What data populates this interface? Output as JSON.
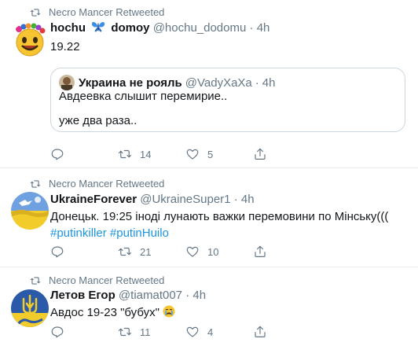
{
  "tweets": [
    {
      "retweeted_by": "Necro Mancer Retweeted",
      "name_part1": "hochu",
      "name_emoji": "butterfly-icon",
      "name_part2": "domoy",
      "handle": "@hochu_dodomu",
      "dot": "·",
      "time": "4h",
      "text": "19.22",
      "quote": {
        "name": "Украина не рояль",
        "handle": "@VadyXaXa",
        "dot": "·",
        "time": "4h",
        "line1": "Авдеевка слышит перемирие..",
        "line2": "уже два раза.."
      },
      "retweets": "14",
      "likes": "5"
    },
    {
      "retweeted_by": "Necro Mancer Retweeted",
      "name": "UkraineForever",
      "handle": "@UkraineSuper1",
      "dot": "·",
      "time": "4h",
      "text": "Донецьк. 19:25 іноді лунають важки перемовини по Мінську(((",
      "hashtag1": "#putinkiller",
      "hashtag2": "#putinHuilo",
      "retweets": "21",
      "likes": "10"
    },
    {
      "retweeted_by": "Necro Mancer Retweeted",
      "name": "Летов Егор",
      "handle": "@tiamat007",
      "dot": "·",
      "time": "4h",
      "text": "Авдос 19-23 \"бубух\"",
      "text_emoji": "crying-face-icon",
      "retweets": "11",
      "likes": "4"
    }
  ],
  "colors": {
    "text": "#14171a",
    "secondary": "#657786",
    "hashtag": "#1b95e0",
    "divider": "#e6ecf0"
  }
}
